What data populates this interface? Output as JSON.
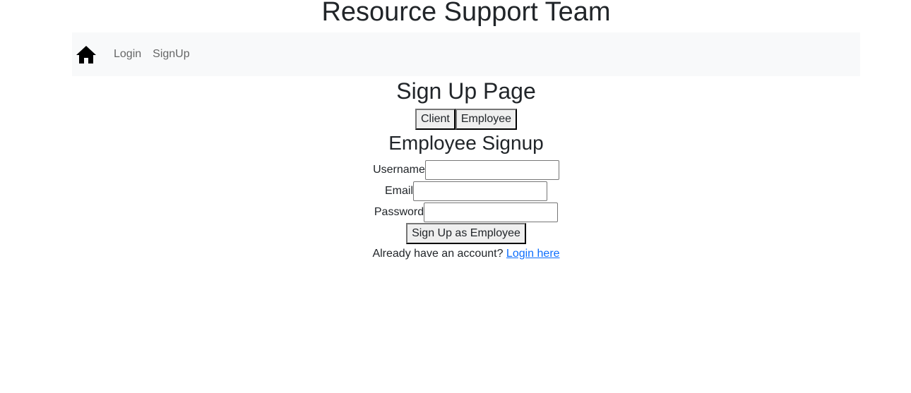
{
  "header": {
    "site_title": "Resource Support Team"
  },
  "navbar": {
    "home_icon": "home-icon",
    "links": [
      {
        "label": "Login"
      },
      {
        "label": "SignUp"
      }
    ]
  },
  "page": {
    "heading": "Sign Up Page",
    "toggle_buttons": [
      {
        "label": "Client"
      },
      {
        "label": "Employee"
      }
    ],
    "form": {
      "title": "Employee Signup",
      "fields": [
        {
          "label": "Username",
          "value": ""
        },
        {
          "label": "Email",
          "value": ""
        },
        {
          "label": "Password",
          "value": ""
        }
      ],
      "submit_label": "Sign Up as Employee"
    },
    "footer": {
      "prompt": "Already have an account?",
      "link_label": "Login here"
    }
  },
  "colors": {
    "navbar_bg": "#f8f9fa",
    "link": "#0d6efd",
    "text": "#212529"
  }
}
